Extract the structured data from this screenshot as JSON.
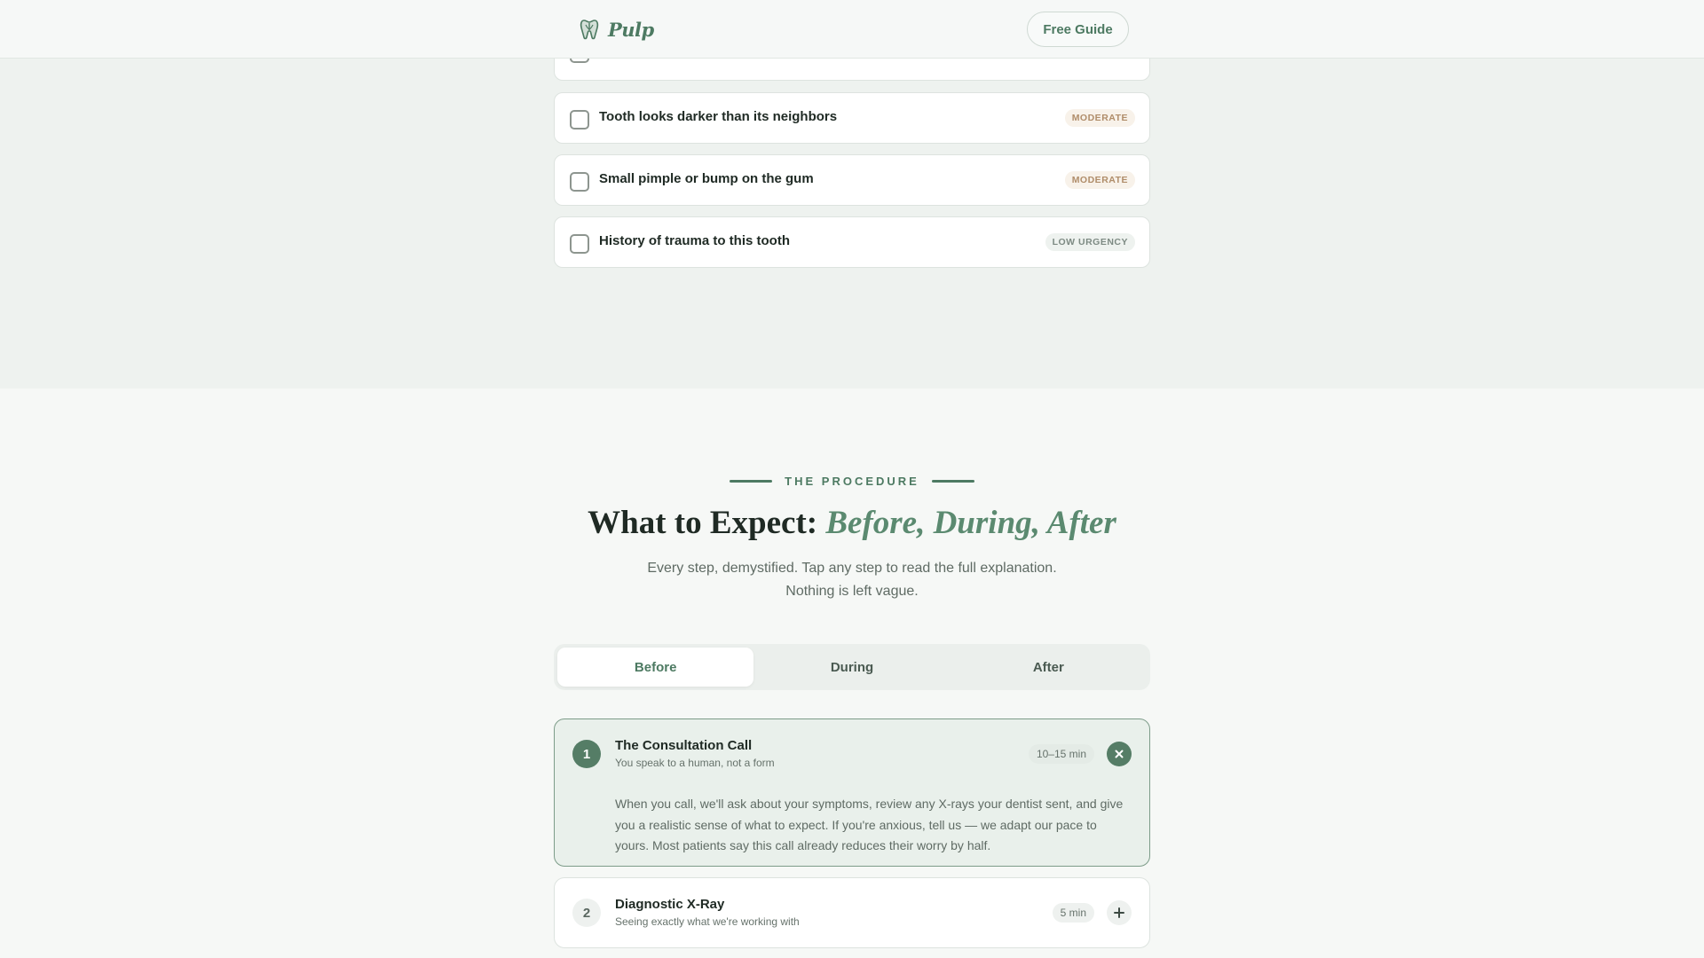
{
  "header": {
    "brand_name": "Pulp",
    "logo_icon": "tooth-icon",
    "guide_button": "Free Guide"
  },
  "symptoms": [
    {
      "label": "",
      "badge": ""
    },
    {
      "label": "Tooth looks darker than its neighbors",
      "badge": "MODERATE"
    },
    {
      "label": "Small pimple or bump on the gum",
      "badge": "MODERATE"
    },
    {
      "label": "History of trauma to this tooth",
      "badge": "LOW URGENCY"
    }
  ],
  "procedure": {
    "eyebrow": "THE PROCEDURE",
    "title_plain": "What to Expect: ",
    "title_accent": "Before, During, After",
    "subtitle_line1": "Every step, demystified. Tap any step to read the full explanation.",
    "subtitle_line2": "Nothing is left vague.",
    "tabs": [
      {
        "label": "Before",
        "active": true
      },
      {
        "label": "During",
        "active": false
      },
      {
        "label": "After",
        "active": false
      }
    ],
    "steps": [
      {
        "number": "1",
        "title": "The Consultation Call",
        "subtitle": "You speak to a human, not a form",
        "duration": "10–15 min",
        "expanded": true,
        "body": "When you call, we'll ask about your symptoms, review any X-rays your dentist sent, and give you a realistic sense of what to expect. If you're anxious, tell us — we adapt our pace to yours. Most patients say this call already reduces their worry by half."
      },
      {
        "number": "2",
        "title": "Diagnostic X-Ray",
        "subtitle": "Seeing exactly what we're working with",
        "duration": "5 min",
        "expanded": false
      }
    ]
  },
  "colors": {
    "accent": "#4d7a62",
    "accent_dark": "#557d66",
    "badge_moderate": "#b08d6a"
  }
}
